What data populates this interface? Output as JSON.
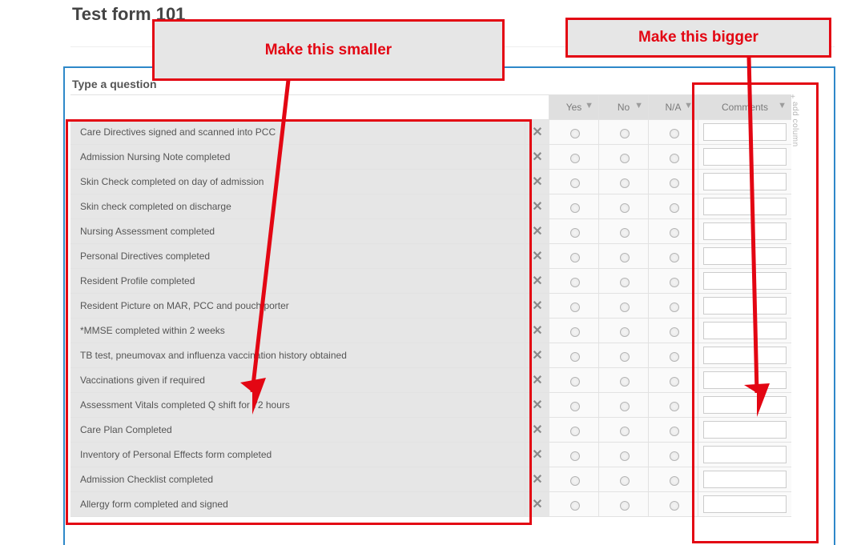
{
  "title": "Test form 101",
  "question_placeholder": "Type a question",
  "columns": [
    "Yes",
    "No",
    "N/A",
    "Comments"
  ],
  "add_column_label": "add column",
  "annotations": {
    "smaller": "Make this smaller",
    "bigger": "Make this bigger"
  },
  "rows": [
    "Care Directives signed and scanned into PCC",
    "Admission Nursing Note completed",
    "Skin Check completed on day of admission",
    "Skin check completed on discharge",
    "Nursing Assessment completed",
    "Personal Directives completed",
    "Resident Profile completed",
    "Resident Picture on MAR, PCC and pouch porter",
    "*MMSE completed within 2 weeks",
    "TB test, pneumovax and influenza vaccination history obtained",
    "Vaccinations given if required",
    "Assessment Vitals completed Q shift for 72 hours",
    "Care Plan Completed",
    "Inventory of Personal Effects form completed",
    "Admission Checklist completed",
    "Allergy form completed and signed"
  ]
}
